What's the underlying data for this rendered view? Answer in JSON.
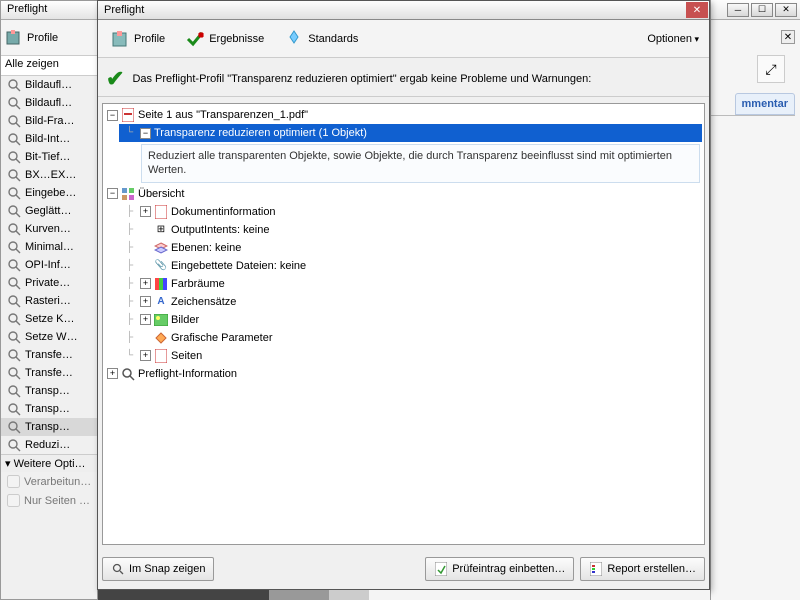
{
  "bg": {
    "tab": "mmentar"
  },
  "back": {
    "title": "Preflight",
    "profileLabel": "Profile",
    "showAll": "Alle zeigen",
    "items": [
      "Bildaufl…",
      "Bildaufl…",
      "Bild-Fra…",
      "Bild-Int…",
      "Bit-Tief…",
      "BX…EX…",
      "Eingebe…",
      "Geglätt…",
      "Kurven…",
      "Minimal…",
      "OPI-Inf…",
      "Private…",
      "Rasteri…",
      "Setze K…",
      "Setze W…",
      "Transfe…",
      "Transfe…",
      "Transp…",
      "Transp…",
      "Transp…",
      "Reduzi…"
    ],
    "selectedIndex": 19,
    "moreOptions": "Weitere Opti…",
    "check1": "Verarbeitun…",
    "check2": "Nur Seiten …"
  },
  "fg": {
    "title": "Preflight",
    "tabs": {
      "profile": "Profile",
      "results": "Ergebnisse",
      "standards": "Standards"
    },
    "options": "Optionen",
    "resultMsg": "Das Preflight-Profil \"Transparenz reduzieren optimiert\" ergab keine Probleme und Warnungen:",
    "page1": "Seite 1 aus \"Transparenzen_1.pdf\"",
    "fixup": "Transparenz reduzieren optimiert (1 Objekt)",
    "fixupDesc": "Reduziert alle transparenten Objekte, sowie Objekte, die durch Transparenz beeinflusst sind mit optimierten Werten.",
    "overview": "Übersicht",
    "o1": "Dokumentinformation",
    "o2": "OutputIntents: keine",
    "o3": "Ebenen: keine",
    "o4": "Eingebettete Dateien: keine",
    "o5": "Farbräume",
    "o6": "Zeichensätze",
    "o7": "Bilder",
    "o8": "Grafische Parameter",
    "o9": "Seiten",
    "pinfo": "Preflight-Information",
    "btnSnap": "Im Snap zeigen",
    "btnEmbed": "Prüfeintrag einbetten…",
    "btnReport": "Report erstellen…"
  }
}
